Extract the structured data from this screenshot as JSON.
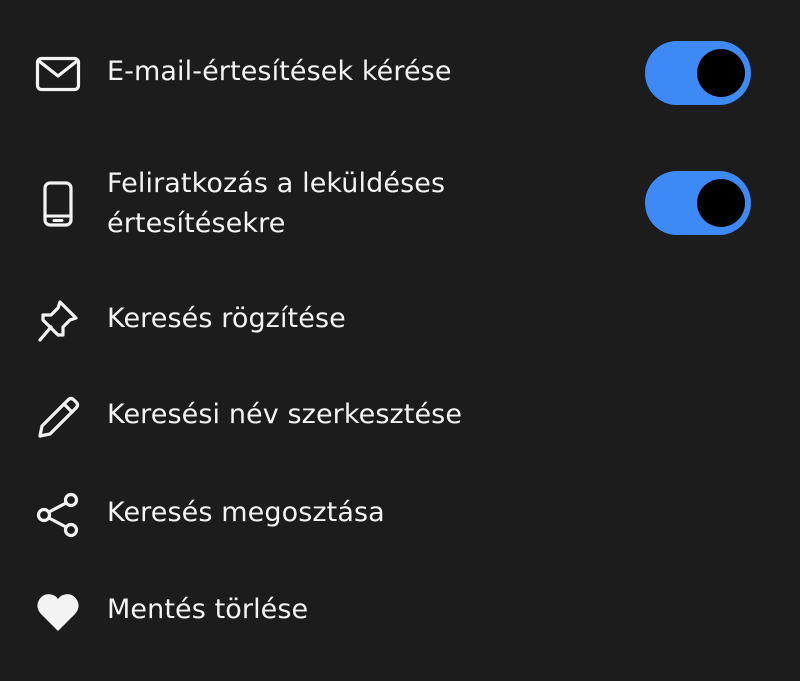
{
  "colors": {
    "background": "#1c1c1c",
    "text": "#f3f3f3",
    "toggle_on": "#3d8af7",
    "toggle_knob": "#000000"
  },
  "menu": {
    "items": [
      {
        "id": "email",
        "icon": "envelope-icon",
        "label": "E-mail-értesítések kérése",
        "toggle": true,
        "toggle_state": "on"
      },
      {
        "id": "push",
        "icon": "phone-icon",
        "label_line1": "Feliratkozás a leküldéses",
        "label_line2": "értesítésekre",
        "toggle": true,
        "toggle_state": "on"
      },
      {
        "id": "pin",
        "icon": "pin-icon",
        "label": "Keresés rögzítése"
      },
      {
        "id": "rename",
        "icon": "pencil-icon",
        "label": "Keresési név szerkesztése"
      },
      {
        "id": "share",
        "icon": "share-icon",
        "label": "Keresés megosztása"
      },
      {
        "id": "delete",
        "icon": "heart-icon",
        "label": "Mentés törlése"
      }
    ]
  }
}
